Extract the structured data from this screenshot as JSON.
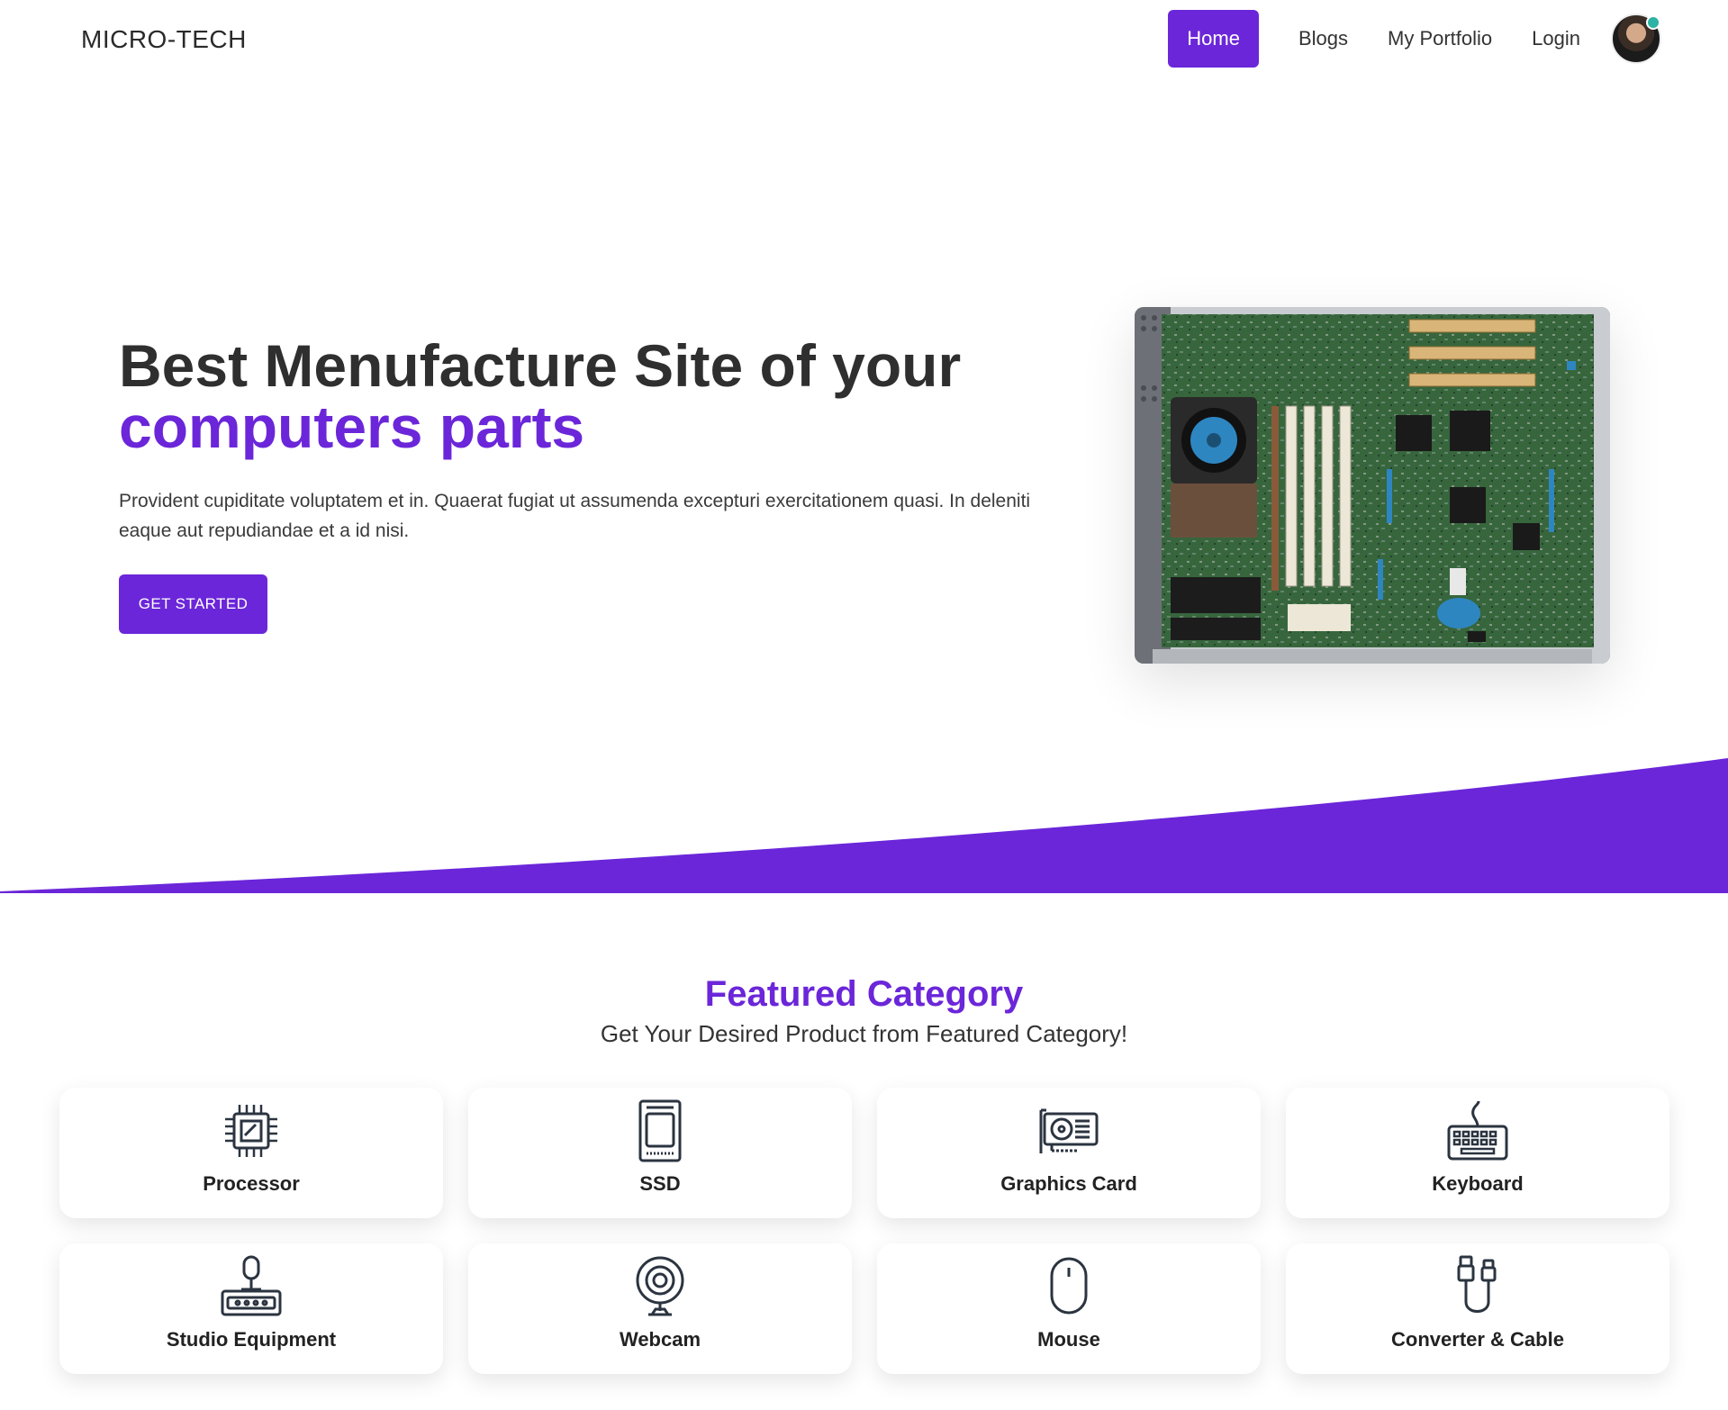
{
  "brand": "MICRO-TECH",
  "nav": {
    "home": "Home",
    "blogs": "Blogs",
    "portfolio": "My Portfolio",
    "login": "Login"
  },
  "hero": {
    "title_line1": "Best Menufacture Site of your",
    "title_line2": "computers parts",
    "description": "Provident cupiditate voluptatem et in. Quaerat fugiat ut assumenda excepturi exercitationem quasi. In deleniti eaque aut repudiandae et a id nisi.",
    "cta": "GET STARTED"
  },
  "featured": {
    "title": "Featured Category",
    "subtitle": "Get Your Desired Product from Featured Category!",
    "categories": [
      {
        "label": "Processor",
        "icon": "processor-icon"
      },
      {
        "label": "SSD",
        "icon": "ssd-icon"
      },
      {
        "label": "Graphics Card",
        "icon": "graphics-card-icon"
      },
      {
        "label": "Keyboard",
        "icon": "keyboard-icon"
      },
      {
        "label": "Studio Equipment",
        "icon": "studio-equipment-icon"
      },
      {
        "label": "Webcam",
        "icon": "webcam-icon"
      },
      {
        "label": "Mouse",
        "icon": "mouse-icon"
      },
      {
        "label": "Converter & Cable",
        "icon": "cable-icon"
      }
    ]
  },
  "colors": {
    "accent": "#6b26d9",
    "text": "#2f2f2f"
  }
}
